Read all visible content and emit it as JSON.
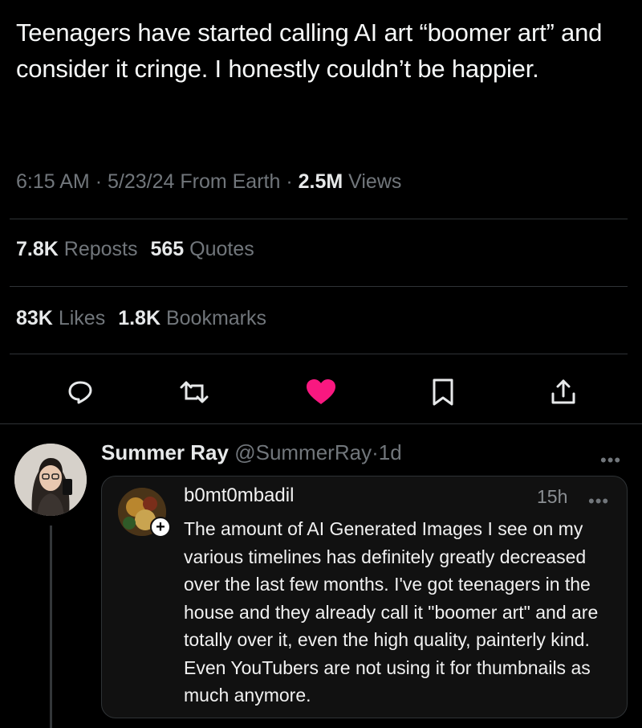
{
  "tweet": {
    "text": "Teenagers have started calling AI art “boomer art” and consider it cringe. I honestly couldn’t be happier.",
    "time": "6:15 AM",
    "date": "5/23/24",
    "source": "From Earth",
    "views_count": "2.5M",
    "views_label": "Views",
    "sep": "·"
  },
  "stats": {
    "reposts_count": "7.8K",
    "reposts_label": "Reposts",
    "quotes_count": "565",
    "quotes_label": "Quotes",
    "likes_count": "83K",
    "likes_label": "Likes",
    "bookmarks_count": "1.8K",
    "bookmarks_label": "Bookmarks"
  },
  "actions": {
    "icons": [
      "reply-icon",
      "repost-icon",
      "like-icon",
      "bookmark-icon",
      "share-icon"
    ],
    "like_color": "#f91880",
    "icon_color": "#e7e9ea"
  },
  "reply": {
    "name": "Summer Ray",
    "handle": "@SummerRay",
    "sep": "·",
    "age": "1d",
    "more": "•••",
    "quote": {
      "handle": "b0mt0mbadil",
      "time": "15h",
      "more": "•••",
      "plus": "+",
      "text": "The amount of AI Generated Images I see on my various timelines has definitely greatly decreased over the last few months. I've got teenagers in the house and they already call it \"boomer art\" and are totally over it, even the high quality, painterly kind. Even YouTubers are not using it for thumbnails as much anymore."
    }
  }
}
